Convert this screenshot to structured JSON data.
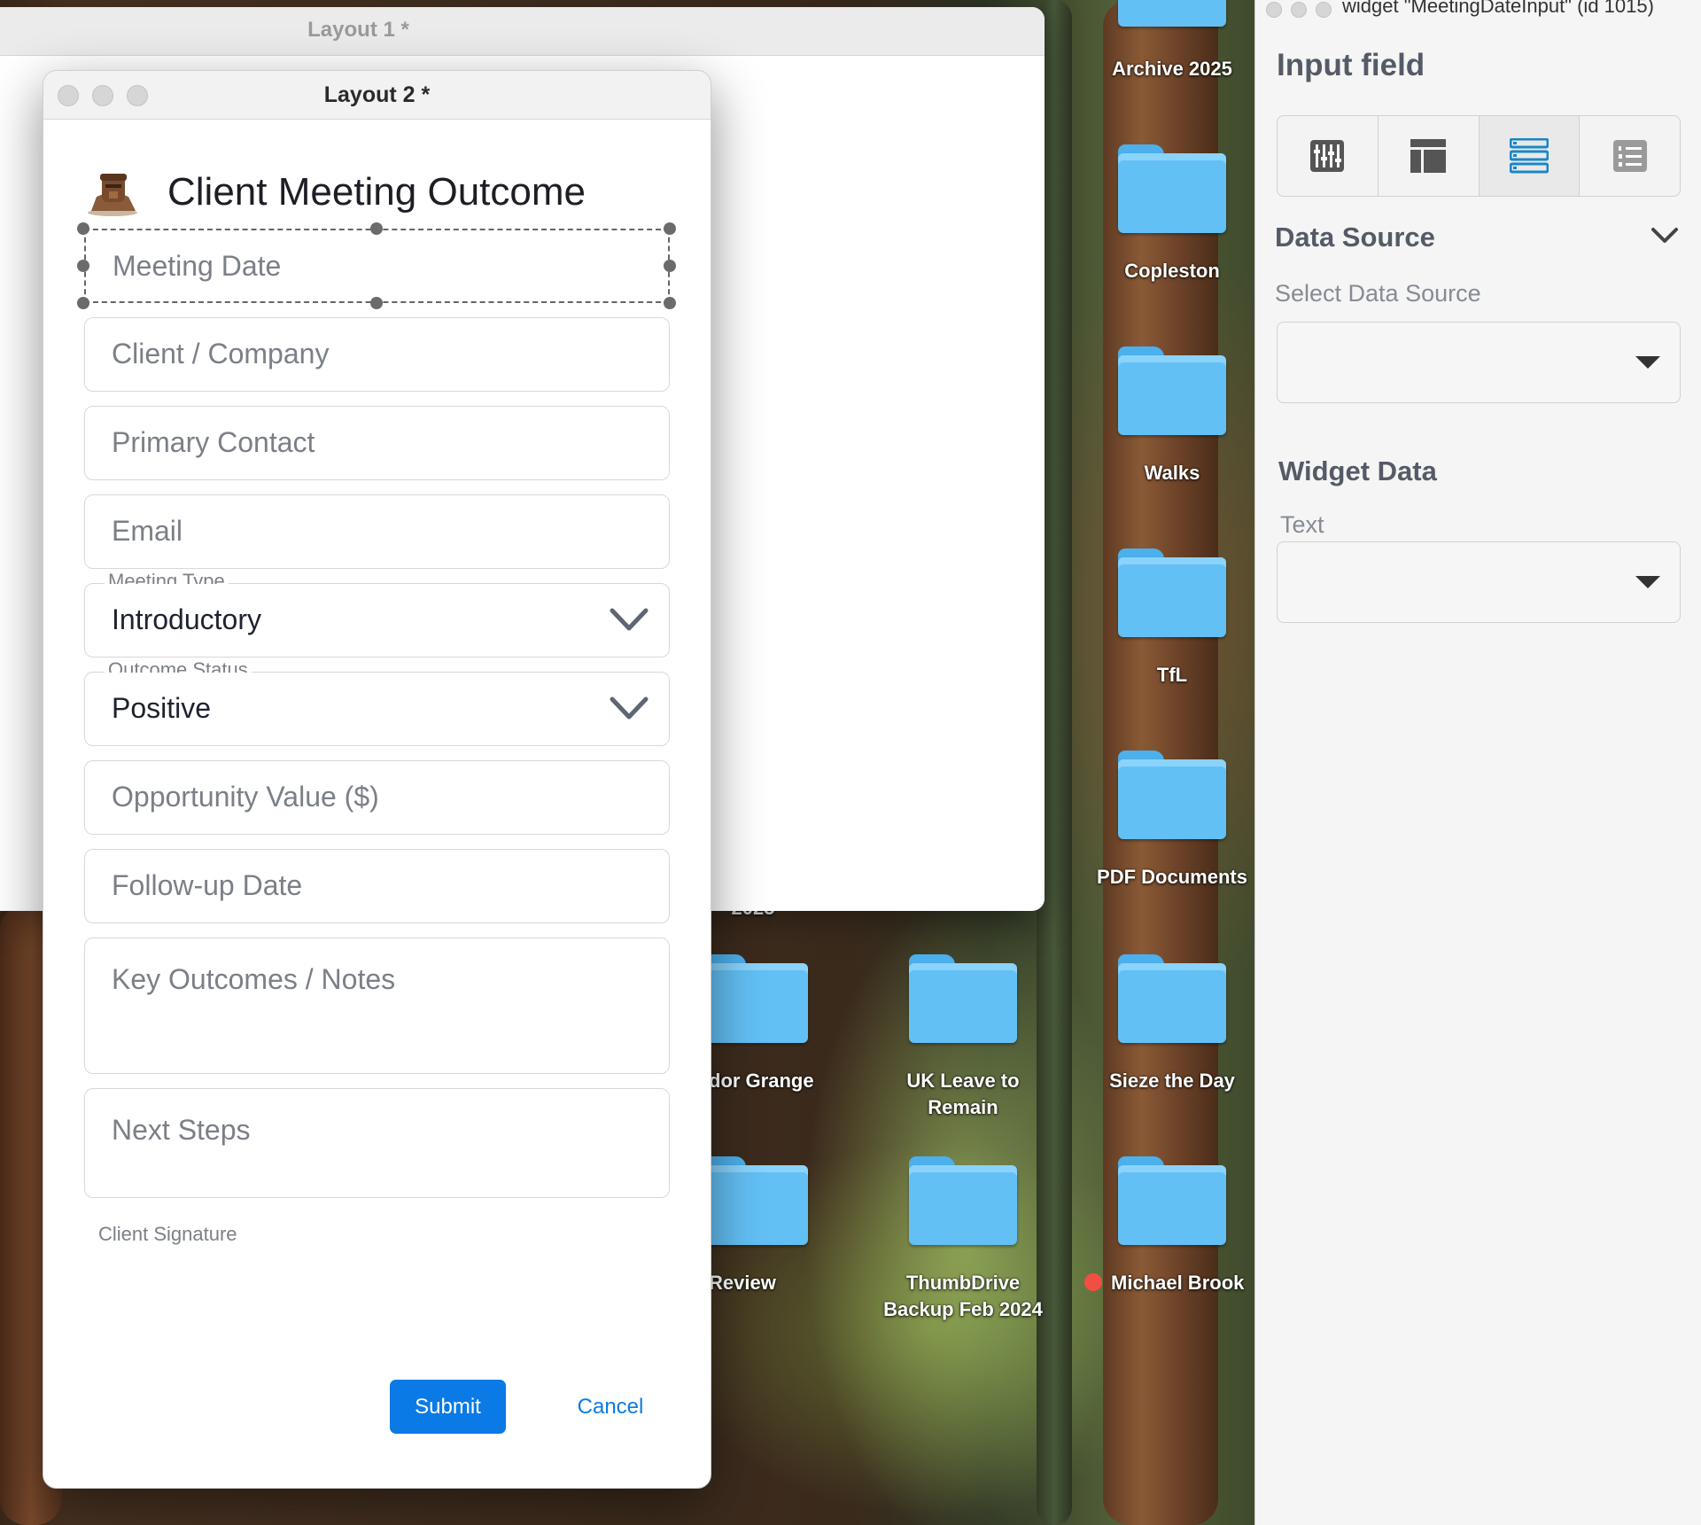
{
  "desktop": {
    "folders": [
      {
        "label": "Archive 2025"
      },
      {
        "label": "Copleston"
      },
      {
        "label": "Walks"
      },
      {
        "label": "TfL"
      },
      {
        "label": "PDF Documents"
      },
      {
        "label": "dor Grange"
      },
      {
        "label": "UK Leave to\nRemain"
      },
      {
        "label": "Sieze the Day"
      },
      {
        "label": "Review"
      },
      {
        "label": "ThumbDrive\nBackup Feb 2024"
      },
      {
        "label": "Michael Brook"
      }
    ],
    "partial_label": "2025"
  },
  "window_back": {
    "title": "Layout 1 *"
  },
  "window_front": {
    "title": "Layout 2 *",
    "form_title": "Client Meeting Outcome",
    "fields": {
      "meeting_date": {
        "placeholder": "Meeting Date"
      },
      "client_company": {
        "placeholder": "Client / Company"
      },
      "primary_contact": {
        "placeholder": "Primary Contact"
      },
      "email": {
        "placeholder": "Email"
      },
      "meeting_type": {
        "legend": "Meeting Type",
        "value": "Introductory"
      },
      "outcome_status": {
        "legend": "Outcome Status",
        "value": "Positive"
      },
      "opportunity_value": {
        "placeholder": "Opportunity Value ($)"
      },
      "follow_up_date": {
        "placeholder": "Follow-up Date"
      },
      "key_outcomes": {
        "placeholder": "Key Outcomes / Notes"
      },
      "next_steps": {
        "placeholder": "Next Steps"
      }
    },
    "signature_label": "Client Signature",
    "submit_label": "Submit",
    "cancel_label": "Cancel"
  },
  "inspector": {
    "window_title": "widget \"MeetingDateInput\" (id 1015)",
    "heading": "Input field",
    "layout_icons": [
      "grid-columns-icon",
      "layout-template-icon",
      "rows-list-icon",
      "numbered-list-icon"
    ],
    "active_icon_index": 2,
    "data_source": {
      "heading": "Data Source",
      "label": "Select Data Source",
      "value": ""
    },
    "widget_data": {
      "heading": "Widget Data",
      "label": "Text",
      "value": ""
    }
  },
  "colors": {
    "accent": "#0a7ae6",
    "selected_icon": "#1a86c7",
    "folder": "#63c0f5",
    "tag_red": "#f24e43"
  }
}
